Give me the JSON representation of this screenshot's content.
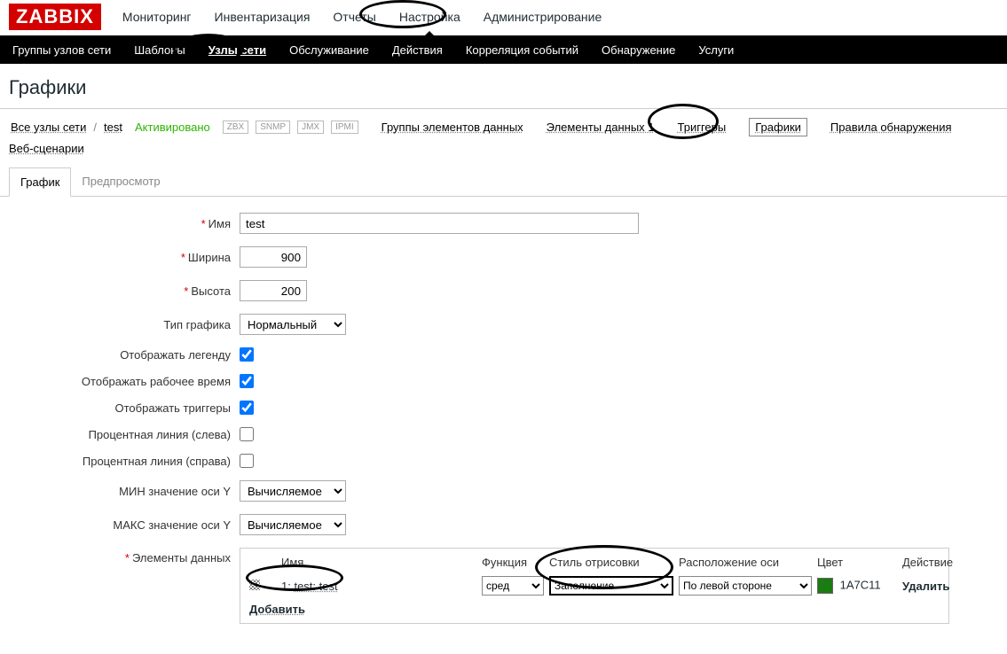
{
  "logo": "ZABBIX",
  "main_tabs": {
    "monitoring": "Мониторинг",
    "inventory": "Инвентаризация",
    "reports": "Отчеты",
    "config": "Настройка",
    "admin": "Администрирование"
  },
  "sub_tabs": {
    "hostgroups": "Группы узлов сети",
    "templates": "Шаблоны",
    "hosts": "Узлы сети",
    "maintenance": "Обслуживание",
    "actions": "Действия",
    "correlation": "Корреляция событий",
    "discovery": "Обнаружение",
    "services": "Услуги"
  },
  "page_title": "Графики",
  "crumbs": {
    "all_hosts": "Все узлы сети",
    "sep": "/",
    "host": "test",
    "status": "Активировано",
    "badges": [
      "ZBX",
      "SNMP",
      "JMX",
      "IPMI"
    ],
    "apps": "Группы элементов данных",
    "items": "Элементы данных 1",
    "triggers": "Триггеры",
    "graphs": "Графики",
    "drules": "Правила обнаружения",
    "web": "Веб-сценарии"
  },
  "inner_tabs": {
    "graph": "График",
    "preview": "Предпросмотр"
  },
  "labels": {
    "name": "Имя",
    "width": "Ширина",
    "height": "Высота",
    "gtype": "Тип графика",
    "legend": "Отображать легенду",
    "worktime": "Отображать рабочее время",
    "triggers": "Отображать триггеры",
    "pleft": "Процентная линия (слева)",
    "pright": "Процентная линия (справа)",
    "ymin": "МИН значение оси Y",
    "ymax": "МАКС значение оси Y",
    "items": "Элементы данных"
  },
  "values": {
    "name": "test",
    "width": "900",
    "height": "200",
    "gtype": "Нормальный",
    "ymin": "Вычисляемое",
    "ymax": "Вычисляемое"
  },
  "items_table": {
    "headers": {
      "name": "Имя",
      "func": "Функция",
      "style": "Стиль отрисовки",
      "axis": "Расположение оси",
      "color": "Цвет",
      "action": "Действие"
    },
    "row": {
      "index": "1:",
      "name": "test: test",
      "func": "сред",
      "style": "Заполнение",
      "axis": "По левой стороне",
      "color_hex": "1A7C11",
      "color_css": "#1A7C11",
      "del": "Удалить"
    },
    "add": "Добавить"
  }
}
